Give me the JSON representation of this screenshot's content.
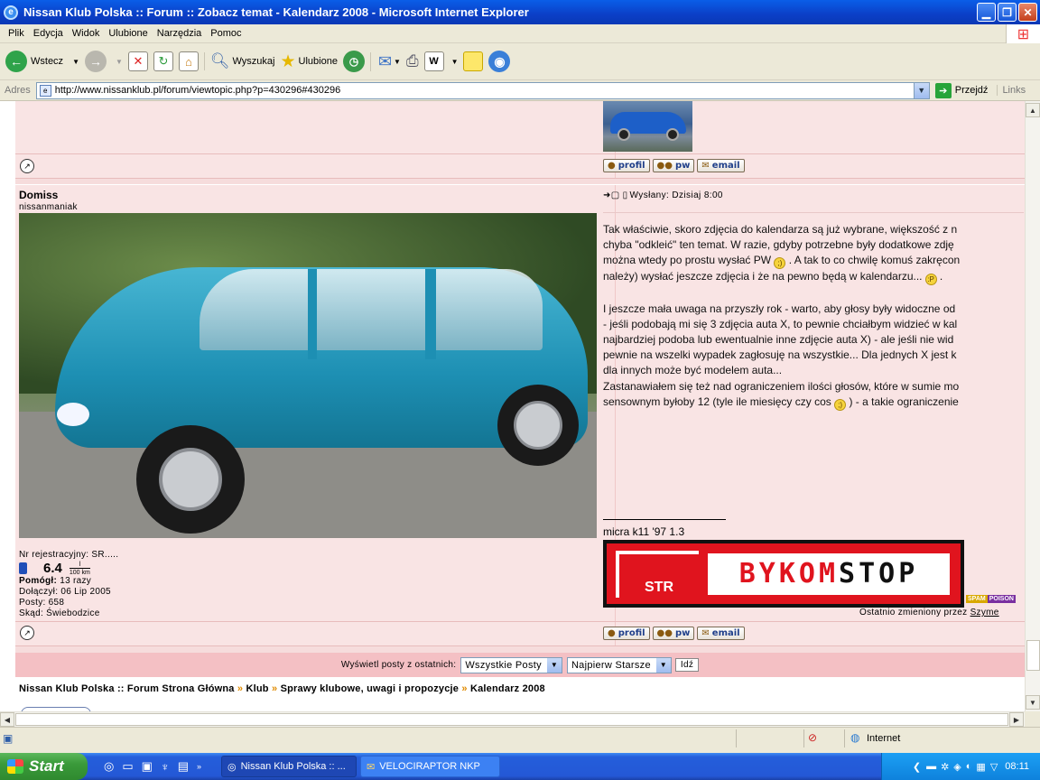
{
  "window": {
    "title": "Nissan Klub Polska :: Forum :: Zobacz temat - Kalendarz 2008 - Microsoft Internet Explorer"
  },
  "menu": [
    "Plik",
    "Edycja",
    "Widok",
    "Ulubione",
    "Narzędzia",
    "Pomoc"
  ],
  "toolbar": {
    "back": "Wstecz",
    "search": "Wyszukaj",
    "favorites": "Ulubione"
  },
  "address": {
    "label": "Adres",
    "url": "http://www.nissanklub.pl/forum/viewtopic.php?p=430296#430296",
    "go": "Przejdź",
    "links": "Links"
  },
  "post1": {
    "buttons": [
      "profil",
      "pw",
      "email"
    ]
  },
  "post2": {
    "author": "Domiss",
    "rank": "nissanmaniak",
    "posted": "Wysłany: Dzisiaj 8:00",
    "body": [
      "Tak właściwie, skoro zdjęcia do kalendarza są już wybrane, większość z n",
      "chyba \"odkleić\" ten temat. W razie, gdyby potrzebne były dodatkowe zdję",
      "można wtedy po prostu wysłać PW",
      ". A tak to co chwilę komuś zakręcon",
      "należy) wysłać jeszcze zdjęcia i że na pewno będą w kalendarzu...",
      ".",
      "I jeszcze mała uwaga na przyszły rok - warto, aby głosy były widoczne od",
      "- jeśli podobają mi się 3 zdjęcia auta X, to pewnie chciałbym widzieć w kal",
      "najbardziej podoba lub ewentualnie inne zdjęcie auta X) - ale jeśli nie wid",
      "pewnie na wszelki wypadek zagłosuję na wszystkie... Dla jednych X jest k",
      "dla innych może być modelem auta...",
      "Zastanawiałem się też nad ograniczeniem ilości głosów, które w sumie mo",
      "sensownym byłoby 12 (tyle ile miesięcy czy cos",
      ") - a takie ograniczenie"
    ],
    "signature": "micra k11 '97 1.3",
    "banner": {
      "part1": "BYKOM",
      "part2": "STOP",
      "mark": "STR"
    },
    "badge": {
      "left": "SPAM",
      "right": "POISON"
    },
    "edited": "Ostatnio zmieniony przez",
    "edited_user": "Szyme",
    "reg": "Nr rejestracyjny: SR.....",
    "consumption": "6.4",
    "unit_top": "l",
    "unit_bottom": "100 km",
    "helped_label": "Pomógł:",
    "helped_value": "13 razy",
    "joined": "Dołączył: 06 Lip 2005",
    "posts": "Posty: 658",
    "from": "Skąd: Świebodzice",
    "buttons": [
      "profil",
      "pw",
      "email"
    ]
  },
  "filter": {
    "label": "Wyświetl posty z ostatnich:",
    "range": "Wszystkie Posty",
    "order": "Najpierw Starsze",
    "go": "Idź"
  },
  "breadcrumb": [
    "Nissan Klub Polska :: Forum Strona Główna",
    "Klub",
    "Sprawy klubowe, uwagi i propozycje",
    "Kalendarz 2008"
  ],
  "status": {
    "zone": "Internet"
  },
  "taskbar": {
    "start": "Start",
    "tasks": [
      "Nissan Klub Polska :: ...",
      "VELOCIRAPTOR NKP"
    ],
    "clock": "08:11"
  }
}
